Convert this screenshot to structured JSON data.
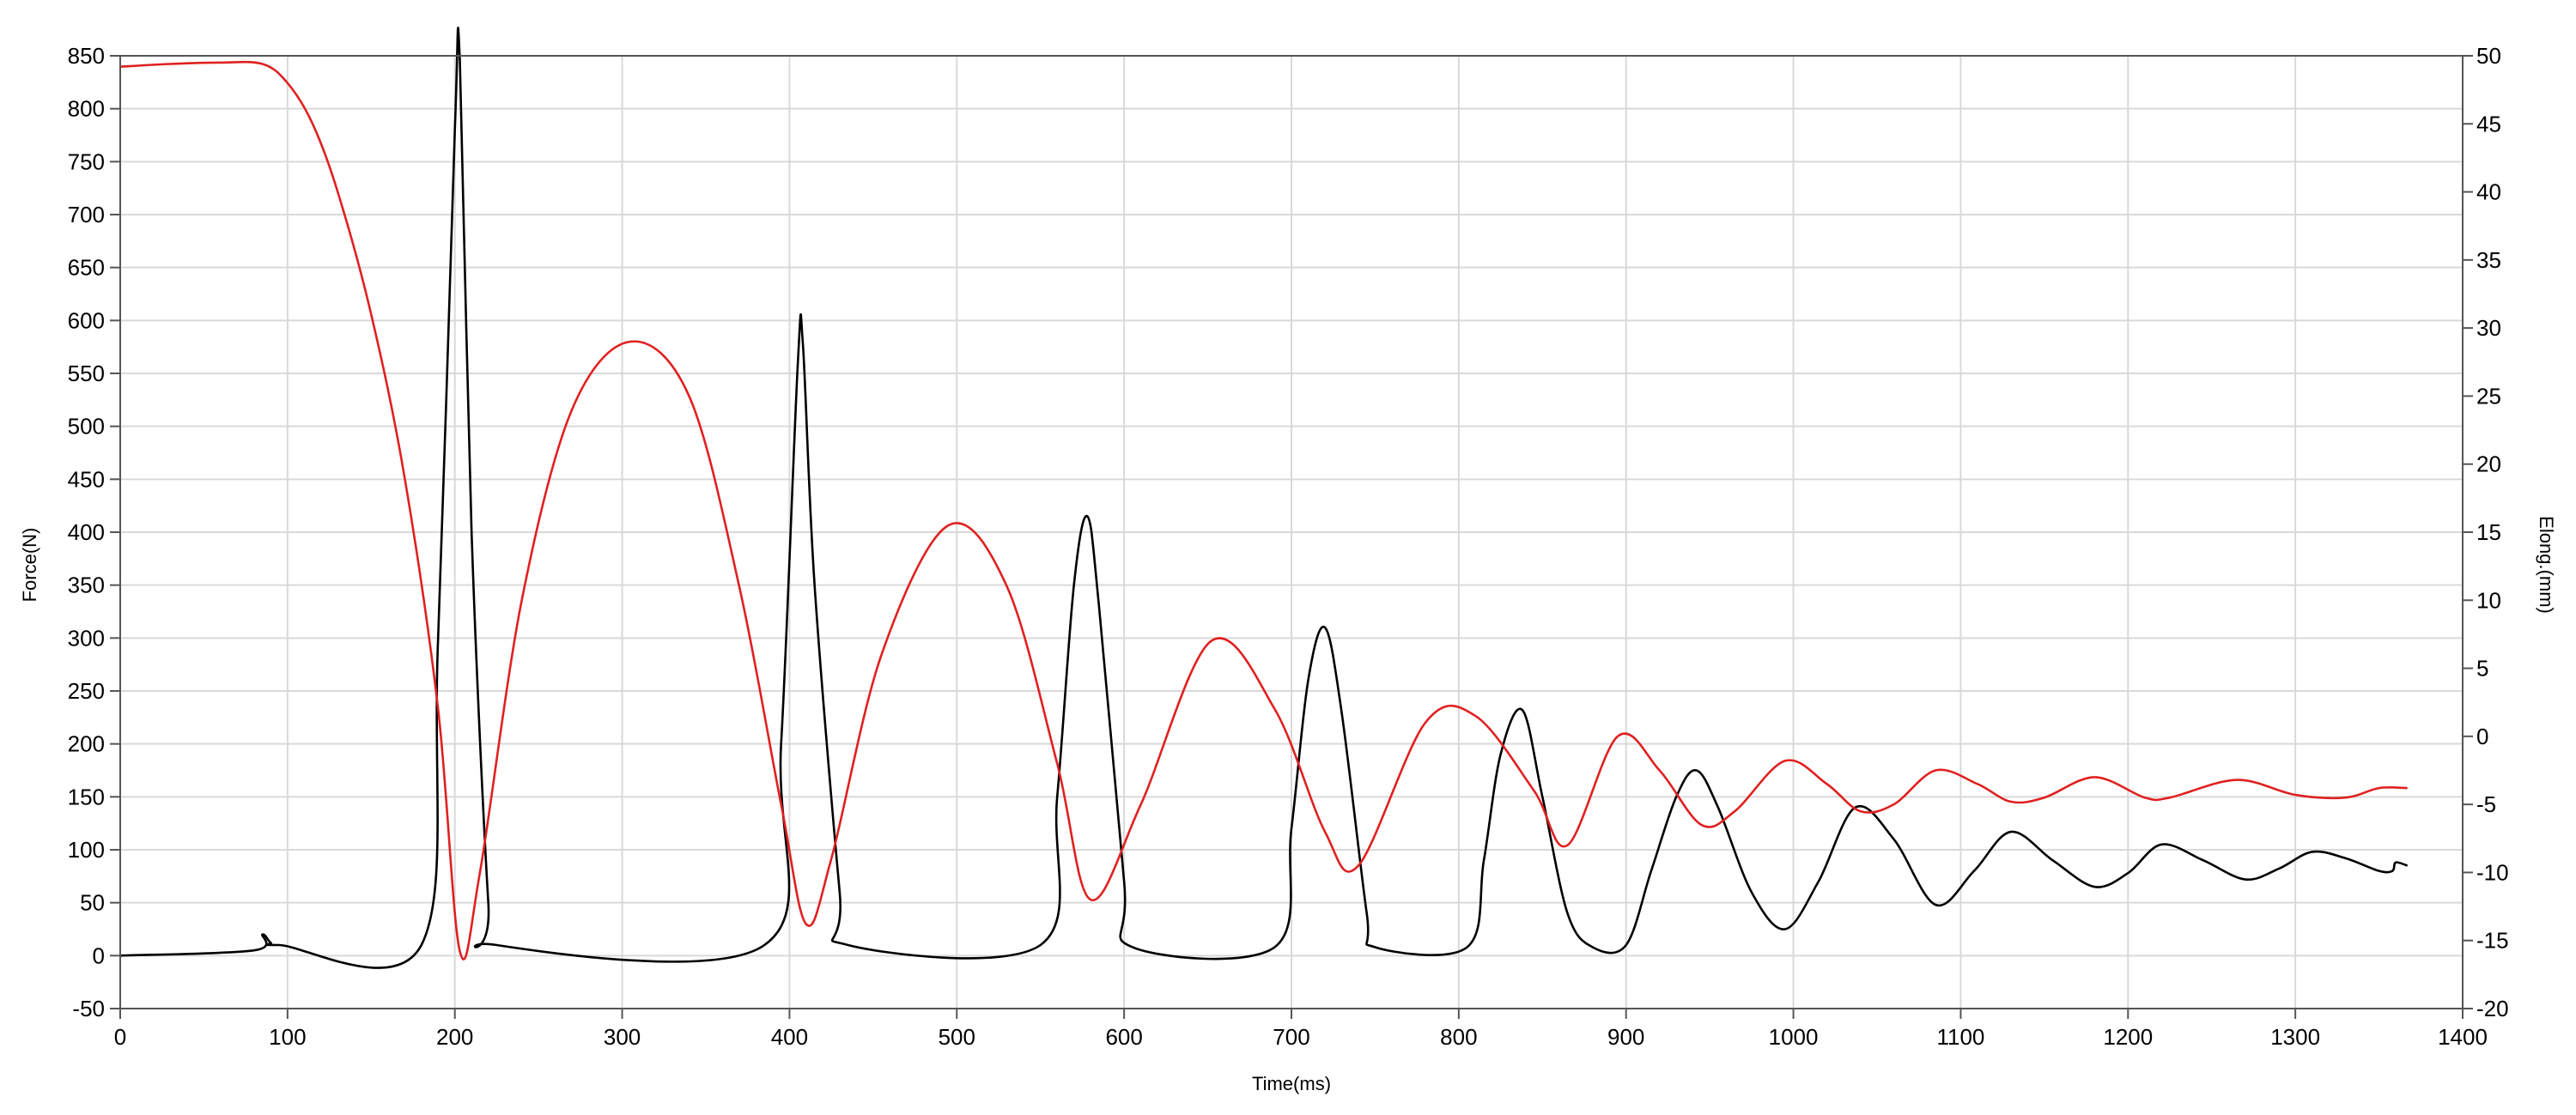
{
  "chart_data": {
    "type": "line",
    "xlabel": "Time(ms)",
    "ylabel_left": "Force(N)",
    "ylabel_right": "Elong.(mm)",
    "xlim": [
      0,
      1400
    ],
    "ylim_left": [
      -50,
      850
    ],
    "ylim_right": [
      -20,
      50
    ],
    "grid": true,
    "x_ticks": [
      0,
      100,
      200,
      300,
      400,
      500,
      600,
      700,
      800,
      900,
      1000,
      1100,
      1200,
      1300,
      1400
    ],
    "y_left_ticks": [
      -50,
      0,
      50,
      100,
      150,
      200,
      250,
      300,
      350,
      400,
      450,
      500,
      550,
      600,
      650,
      700,
      750,
      800,
      850
    ],
    "y_right_ticks": [
      -20,
      -15,
      -10,
      -5,
      0,
      5,
      10,
      15,
      20,
      25,
      30,
      35,
      40,
      45,
      50
    ],
    "series": [
      {
        "axis": "left",
        "color": "#000000",
        "x": [
          0,
          80,
          85,
          90,
          95,
          180,
          190,
          200,
          203,
          210,
          220,
          225,
          385,
          395,
          405,
          408,
          415,
          430,
          435,
          550,
          560,
          570,
          578,
          585,
          600,
          605,
          690,
          700,
          710,
          720,
          730,
          745,
          750,
          805,
          815,
          825,
          838,
          850,
          865,
          880,
          900,
          915,
          930,
          942,
          955,
          975,
          995,
          1015,
          1037,
          1060,
          1085,
          1108,
          1130,
          1155,
          1180,
          1200,
          1220,
          1245,
          1270,
          1290,
          1310,
          1330,
          1350,
          1358,
          1360,
          1367
        ],
        "y": [
          0,
          5,
          20,
          12,
          10,
          10,
          300,
          780,
          845,
          400,
          50,
          10,
          10,
          200,
          560,
          578,
          350,
          60,
          10,
          10,
          150,
          350,
          415,
          330,
          70,
          8,
          8,
          120,
          260,
          310,
          230,
          40,
          8,
          8,
          90,
          190,
          232,
          150,
          40,
          8,
          10,
          80,
          150,
          175,
          140,
          60,
          25,
          70,
          140,
          110,
          48,
          80,
          117,
          90,
          65,
          78,
          105,
          90,
          72,
          82,
          98,
          92,
          80,
          80,
          88,
          85
        ]
      },
      {
        "axis": "right",
        "color": "#e02020",
        "x": [
          0,
          30,
          60,
          85,
          100,
          115,
          130,
          150,
          170,
          190,
          203,
          215,
          240,
          270,
          305,
          340,
          370,
          395,
          410,
          425,
          455,
          495,
          530,
          560,
          580,
          610,
          652,
          690,
          720,
          740,
          780,
          810,
          845,
          865,
          895,
          920,
          945,
          965,
          995,
          1020,
          1040,
          1060,
          1085,
          1110,
          1130,
          1150,
          1180,
          1210,
          1225,
          1265,
          1300,
          1330,
          1350,
          1367
        ],
        "y": [
          49.2,
          49.4,
          49.5,
          49.4,
          48.0,
          45.0,
          40.0,
          31.0,
          19.0,
          2.0,
          -15.8,
          -10.0,
          10.0,
          24.0,
          29.0,
          25.0,
          11.0,
          -5.0,
          -13.8,
          -9.0,
          6.0,
          15.5,
          11.0,
          -2.0,
          -12.0,
          -5.0,
          7.0,
          2.0,
          -7.0,
          -9.5,
          1.0,
          1.5,
          -4.0,
          -8.0,
          0.0,
          -2.5,
          -6.5,
          -5.5,
          -1.8,
          -3.5,
          -5.5,
          -5.0,
          -2.5,
          -3.5,
          -4.8,
          -4.5,
          -3.0,
          -4.5,
          -4.5,
          -3.2,
          -4.3,
          -4.5,
          -3.8,
          -3.8
        ]
      }
    ]
  }
}
